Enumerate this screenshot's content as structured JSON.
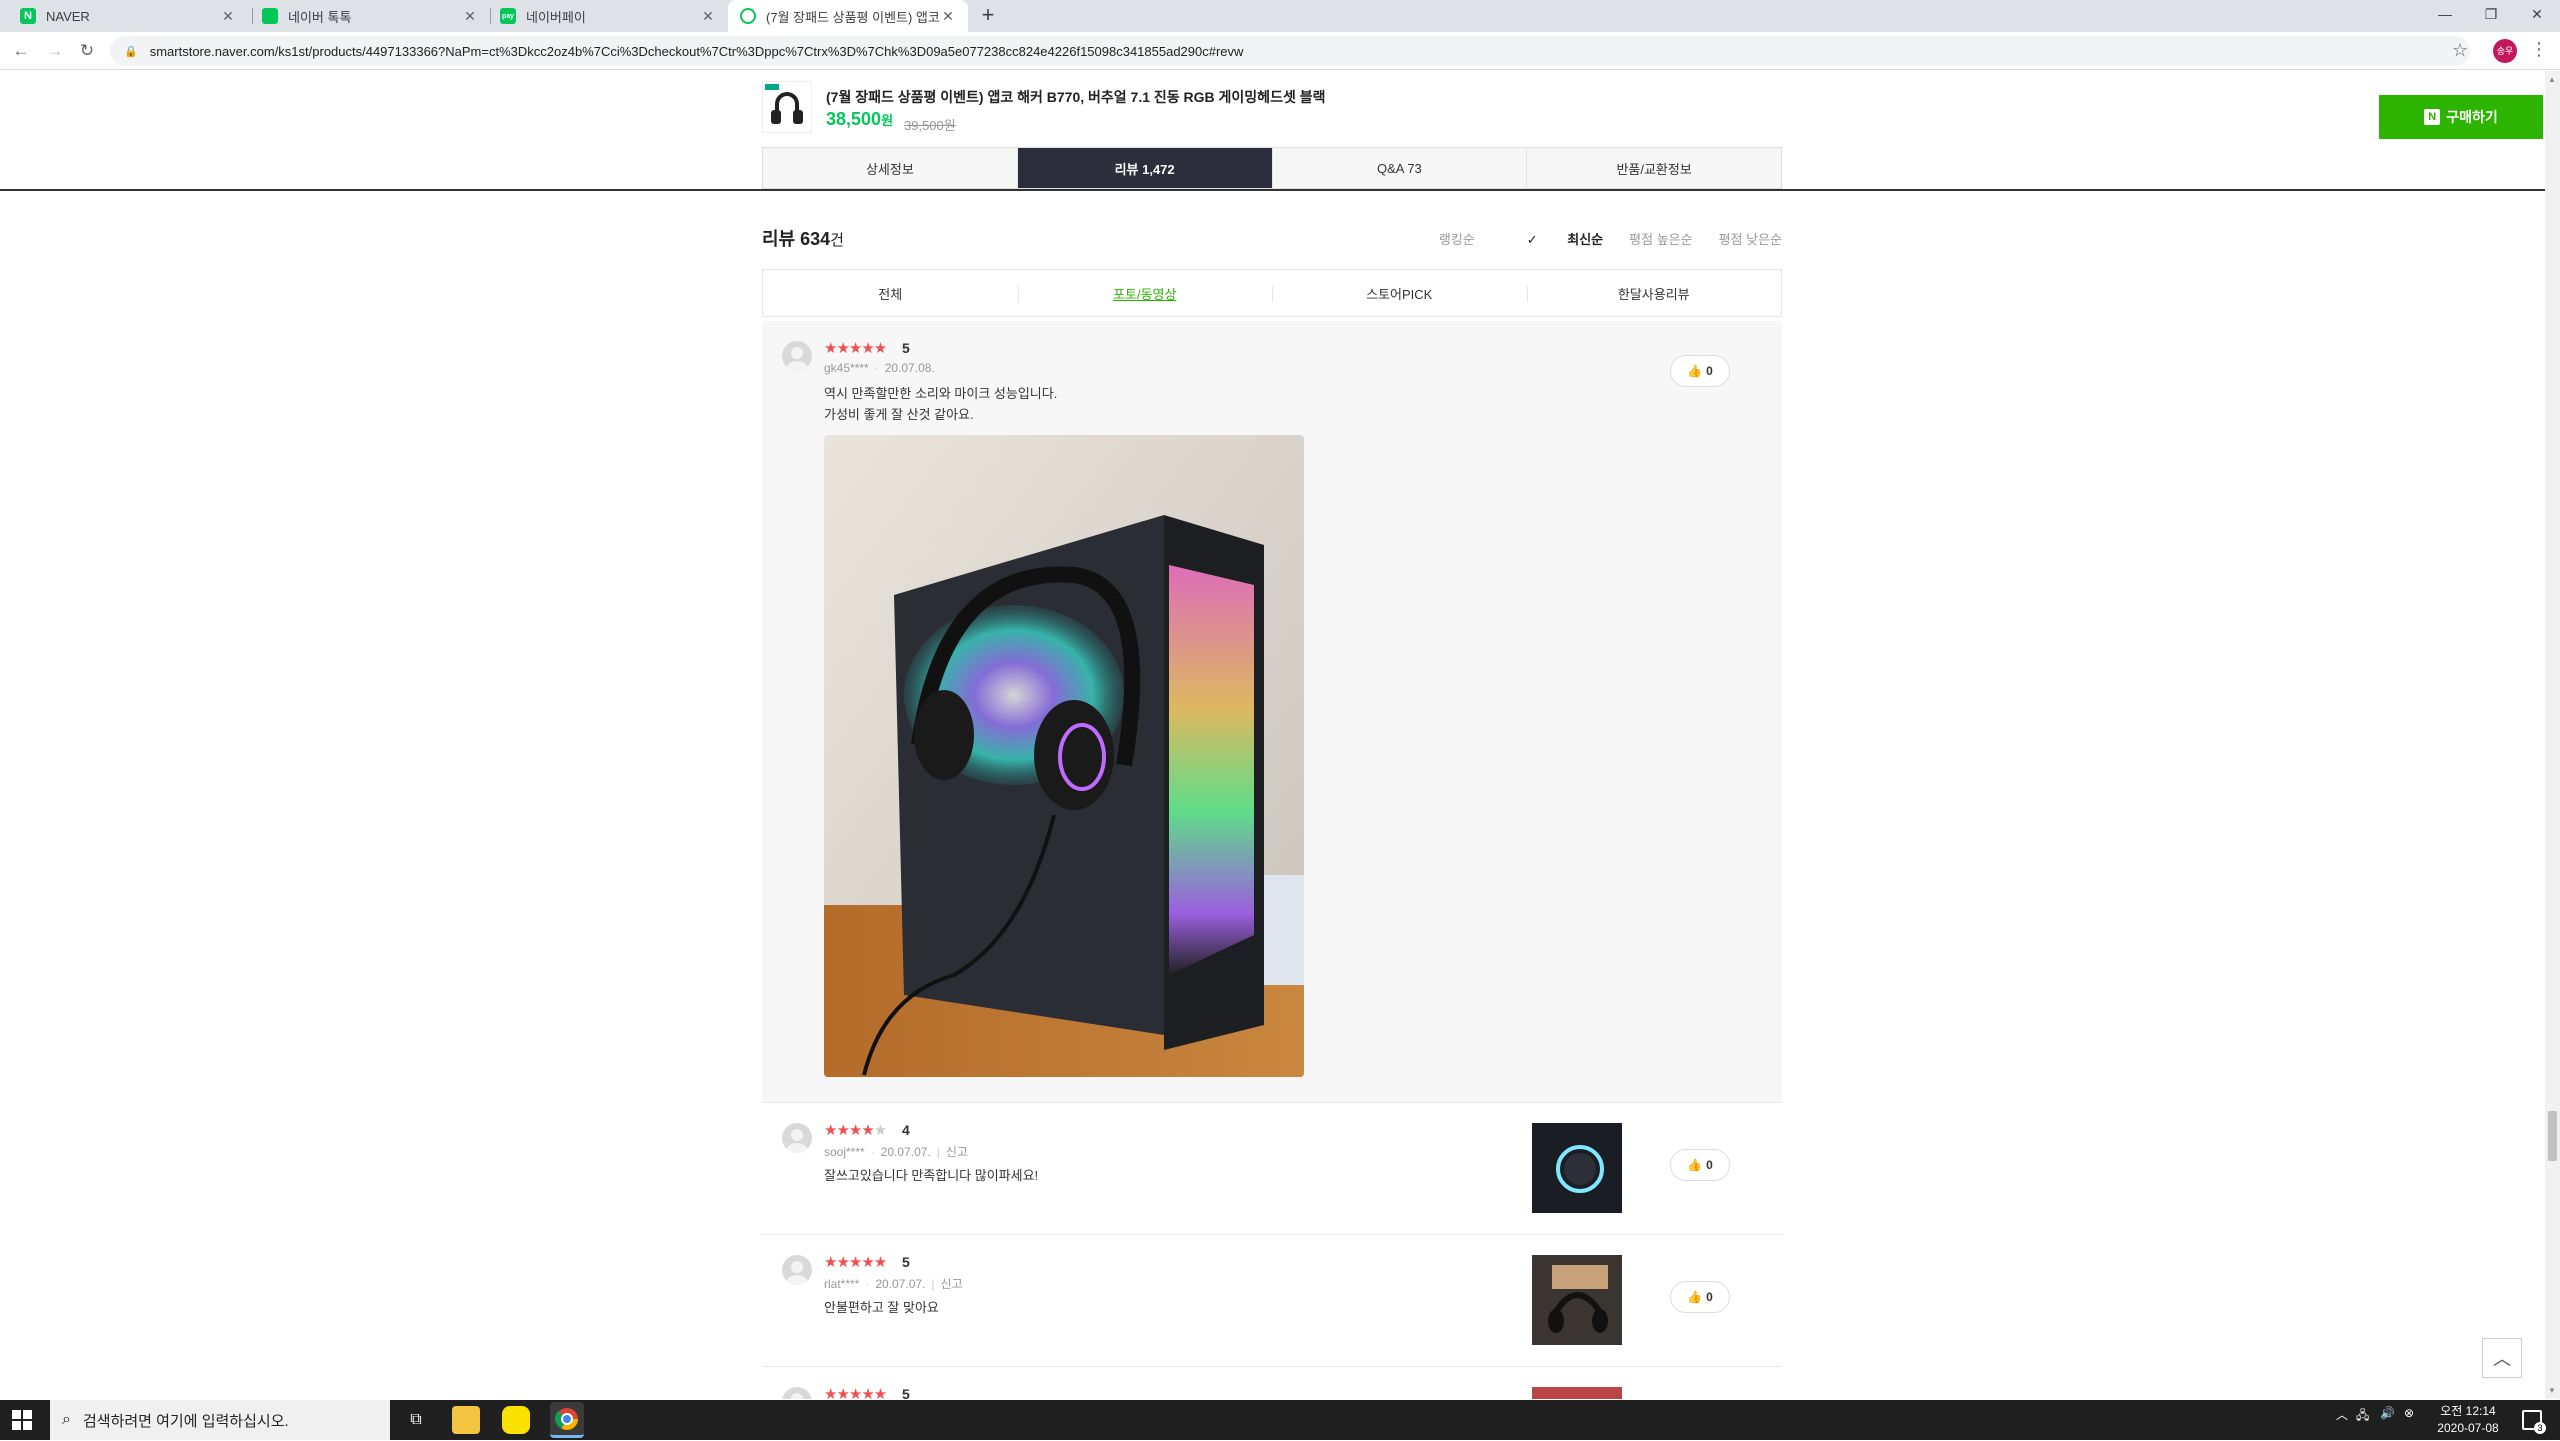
{
  "browser": {
    "tabs": [
      {
        "title": "NAVER",
        "favicon_color": "#03c75a",
        "favicon_letter": "N",
        "active": false
      },
      {
        "title": "네이버 톡톡",
        "favicon_color": "#03c75a",
        "favicon_letter": "톡",
        "active": false
      },
      {
        "title": "네이버페이",
        "favicon_color": "#03c75a",
        "favicon_letter": "pay",
        "active": false
      },
      {
        "title": "(7월 장패드 상품평 이벤트) 앱코",
        "favicon_color": "#03c75a",
        "favicon_letter": "",
        "active": true
      }
    ],
    "url": "smartstore.naver.com/ks1st/products/4497133366?NaPm=ct%3Dkcc2oz4b%7Cci%3Dcheckout%7Ctr%3Dppc%7Ctrx%3D%7Chk%3D09a5e077238cc824e4226f15098c341855ad290c#revw",
    "avatar_text": "송우"
  },
  "product": {
    "title": "(7월 장패드 상품평 이벤트) 앱코 해커 B770, 버추얼 7.1 진동 RGB 게이밍헤드셋 블랙",
    "price": "38,500",
    "price_unit": "원",
    "original_price": "39,500원",
    "buy_label": "구매하기"
  },
  "nav_tabs": [
    "상세정보",
    "리뷰 1,472",
    "Q&A 73",
    "반품/교환정보"
  ],
  "reviews_section": {
    "count_prefix": "리뷰 ",
    "count": "634",
    "count_suffix": "건",
    "sort_options": [
      "랭킹순",
      "최신순",
      "평점 높은순",
      "평점 낮은순"
    ],
    "active_sort": "최신순",
    "filters": [
      "전체",
      "포토/동영상",
      "스토어PICK",
      "한달사용리뷰"
    ],
    "active_filter": "포토/동영상"
  },
  "reviews": [
    {
      "rating": 5,
      "user": "gk45****",
      "date": "20.07.08.",
      "report": "",
      "text_line1": "역시 만족할만한 소리와 마이크 성능입니다.",
      "text_line2": "가성비 좋게 잘 산것 같아요.",
      "likes": "0"
    },
    {
      "rating": 4,
      "user": "sooj****",
      "date": "20.07.07.",
      "report": "신고",
      "text_line1": "잘쓰고있습니다 만족합니다 많이파세요!",
      "likes": "0"
    },
    {
      "rating": 5,
      "user": "rlat****",
      "date": "20.07.07.",
      "report": "신고",
      "text_line1": "안불편하고 잘 맞아요",
      "likes": "0"
    },
    {
      "rating": 5
    }
  ],
  "taskbar": {
    "search_placeholder": "검색하려면 여기에 입력하십시오.",
    "time": "오전 12:14",
    "date": "2020-07-08",
    "notification_count": "3"
  },
  "colors": {
    "naver_green": "#2db400",
    "star_red": "#f05050",
    "active_tab_dark": "#2c2f3b"
  }
}
